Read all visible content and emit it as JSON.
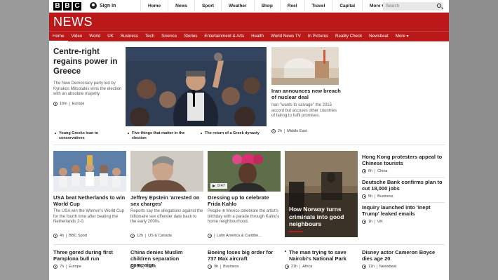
{
  "brand": {
    "logo_letters": [
      "B",
      "B",
      "C"
    ],
    "section_title": "NEWS",
    "accent": "#bb1919"
  },
  "top": {
    "signin_label": "Sign in",
    "nav": [
      "Home",
      "News",
      "Sport",
      "Weather",
      "Shop",
      "Reel",
      "Travel",
      "Capital",
      "More"
    ],
    "search_placeholder": "Search"
  },
  "sections": [
    "Home",
    "Video",
    "World",
    "UK",
    "Business",
    "Tech",
    "Science",
    "Stories",
    "Entertainment & Arts",
    "Health",
    "World News TV",
    "In Pictures",
    "Reality Check",
    "Newsbeat",
    "More"
  ],
  "lead": {
    "headline": "Centre-right regains power in Greece",
    "summary": "The New Democracy party led by Kyriakos Mitsotakis wins the election with an absolute majority.",
    "time": "19m",
    "tag": "Europe",
    "related": [
      "Young Greeks lean to conservatives",
      "Five things that matter in the election",
      "The return of a Greek dynasty"
    ]
  },
  "iran": {
    "headline": "Iran announces new breach of nuclear deal",
    "summary": "Iran \"wants to salvage\" the 2015 accord but accuses other countries of failing to fulfil promises.",
    "time": "2h",
    "tag": "Middle East"
  },
  "row2": [
    {
      "headline": "USA beat Netherlands to win World Cup",
      "summary": "The USA win the Women's World Cup for the fourth time after beating the Netherlands 2-0.",
      "time": "4h",
      "tag": "BBC Sport"
    },
    {
      "headline": "Jeffrey Epstein 'arrested on sex charges'",
      "summary": "Reports say the allegations against the billionaire sex offender date back to the early 2000s.",
      "time": "12h",
      "tag": "US & Canada"
    },
    {
      "headline": "Dressing up to celebrate Frida Kahlo",
      "summary": "People in Mexico celebrate the artist's birthday with a parade through Kahlo's home neighbourhood.",
      "time": "",
      "tag": "Latin America & Caribbe...",
      "video_duration": "0:47"
    }
  ],
  "feature": {
    "headline": "How Norway turns criminals into good neighbours"
  },
  "side": [
    {
      "headline": "Hong Kong protesters appeal to Chinese tourists",
      "time": "6h",
      "tag": "China"
    },
    {
      "headline": "Deutsche Bank confirms plan to cut 18,000 jobs",
      "time": "5h",
      "tag": "Business"
    },
    {
      "headline": "Inquiry launched into 'inept Trump' leaked emails",
      "time": "1h",
      "tag": "UK"
    }
  ],
  "bottom": [
    {
      "headline": "Three gored during first Pamplona bull run",
      "time": "7h",
      "tag": "Europe"
    },
    {
      "headline": "China denies Muslim children separation campaign",
      "time": "8h",
      "tag": "China"
    },
    {
      "headline": "Boeing loses big order for 737 Max aircraft",
      "time": "9h",
      "tag": "Business"
    },
    {
      "headline": "The man trying to save Nairobi's National Park",
      "time": "21h",
      "tag": "Africa"
    },
    {
      "headline": "Disney actor Cameron Boyce dies age 20",
      "time": "11h",
      "tag": "Newsbeat"
    }
  ]
}
